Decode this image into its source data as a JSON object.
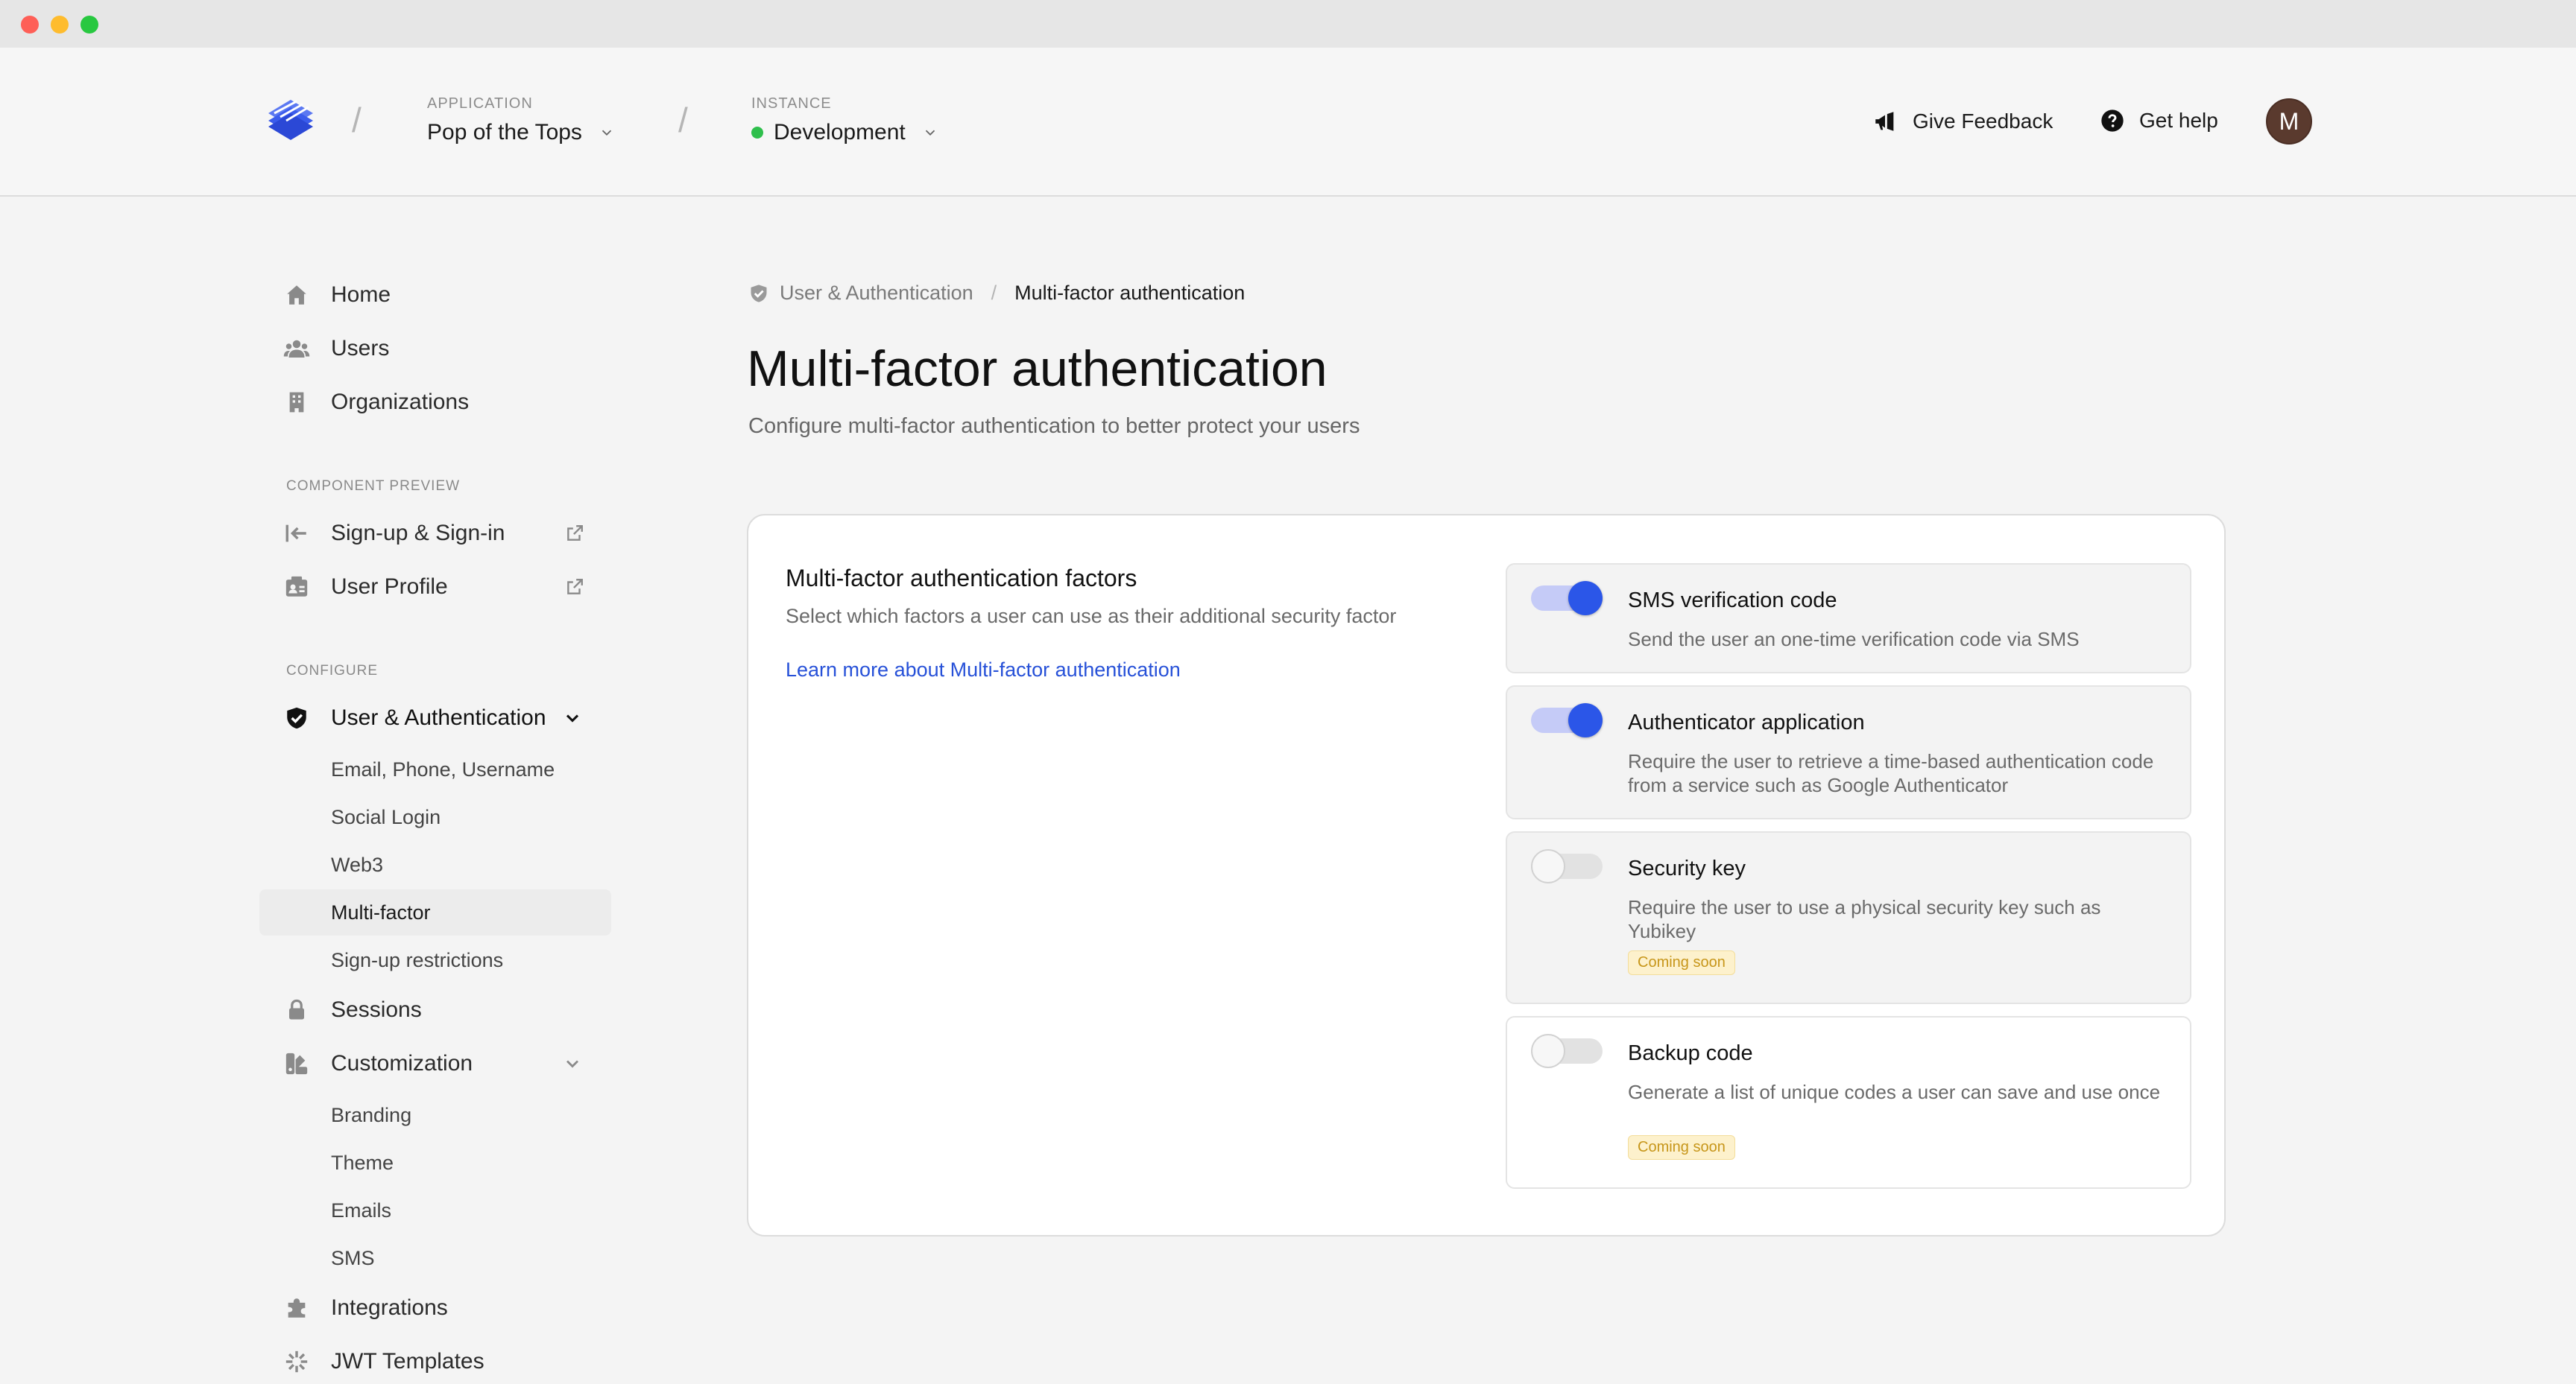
{
  "header": {
    "application": {
      "label": "APPLICATION",
      "value": "Pop of the Tops"
    },
    "instance": {
      "label": "INSTANCE",
      "value": "Development",
      "status_color": "#2fbf4c"
    },
    "give_feedback": "Give Feedback",
    "get_help": "Get help",
    "avatar_initial": "M"
  },
  "sidebar": {
    "main": [
      "Home",
      "Users",
      "Organizations"
    ],
    "component_preview": {
      "title": "COMPONENT PREVIEW",
      "items": [
        "Sign-up & Sign-in",
        "User Profile"
      ]
    },
    "configure": {
      "title": "CONFIGURE",
      "user_auth": "User & Authentication",
      "user_auth_sub": [
        "Email, Phone, Username",
        "Social Login",
        "Web3",
        "Multi-factor",
        "Sign-up restrictions"
      ],
      "sessions": "Sessions",
      "customization": "Customization",
      "customization_sub": [
        "Branding",
        "Theme",
        "Emails",
        "SMS"
      ],
      "integrations": "Integrations",
      "jwt_templates": "JWT Templates"
    }
  },
  "main": {
    "breadcrumb": {
      "parent": "User & Authentication",
      "current": "Multi-factor authentication"
    },
    "title": "Multi-factor authentication",
    "subtitle": "Configure multi-factor authentication to better protect your users",
    "card": {
      "title": "Multi-factor authentication factors",
      "description": "Select which factors a user can use as their additional security factor",
      "link": "Learn more about Multi-factor authentication",
      "factors": [
        {
          "title": "SMS verification code",
          "description": "Send the user an one-time verification code via SMS",
          "enabled": true
        },
        {
          "title": "Authenticator application",
          "description": "Require the user to retrieve a time-based authentication code from a service such as Google Authenticator",
          "enabled": true
        },
        {
          "title": "Security key",
          "description": "Require the user to use a physical security key such as Yubikey",
          "enabled": false,
          "badge": "Coming soon"
        },
        {
          "title": "Backup code",
          "description": "Generate a list of unique codes a user can save and use once",
          "enabled": false,
          "badge": "Coming soon"
        }
      ]
    }
  },
  "colors": {
    "accent": "#2b56e8",
    "link": "#2751d8",
    "badge_text": "#c7961a",
    "badge_bg": "#fdf1cc"
  }
}
